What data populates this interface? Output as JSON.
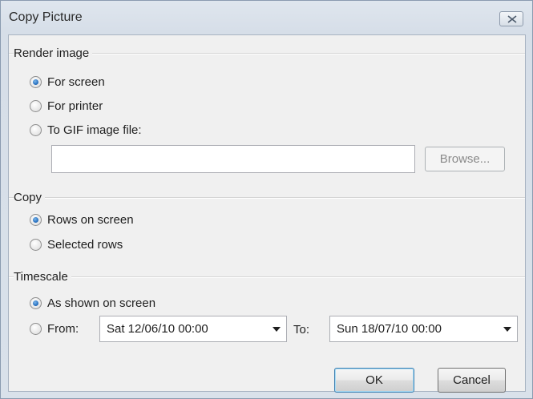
{
  "window": {
    "title": "Copy Picture",
    "close_icon": "close-icon"
  },
  "render_image": {
    "group_label": "Render image",
    "options": [
      {
        "label": "For screen",
        "checked": true
      },
      {
        "label": "For printer",
        "checked": false
      },
      {
        "label": "To GIF image file:",
        "checked": false
      }
    ],
    "file_path_value": "",
    "browse_label": "Browse..."
  },
  "copy": {
    "group_label": "Copy",
    "options": [
      {
        "label": "Rows on screen",
        "checked": true
      },
      {
        "label": "Selected rows",
        "checked": false
      }
    ]
  },
  "timescale": {
    "group_label": "Timescale",
    "options": [
      {
        "label": "As shown on screen",
        "checked": true
      },
      {
        "label": "From:",
        "checked": false
      }
    ],
    "from_value": "Sat 12/06/10 00:00",
    "to_label": "To:",
    "to_value": "Sun 18/07/10 00:00"
  },
  "footer": {
    "ok_label": "OK",
    "cancel_label": "Cancel"
  }
}
